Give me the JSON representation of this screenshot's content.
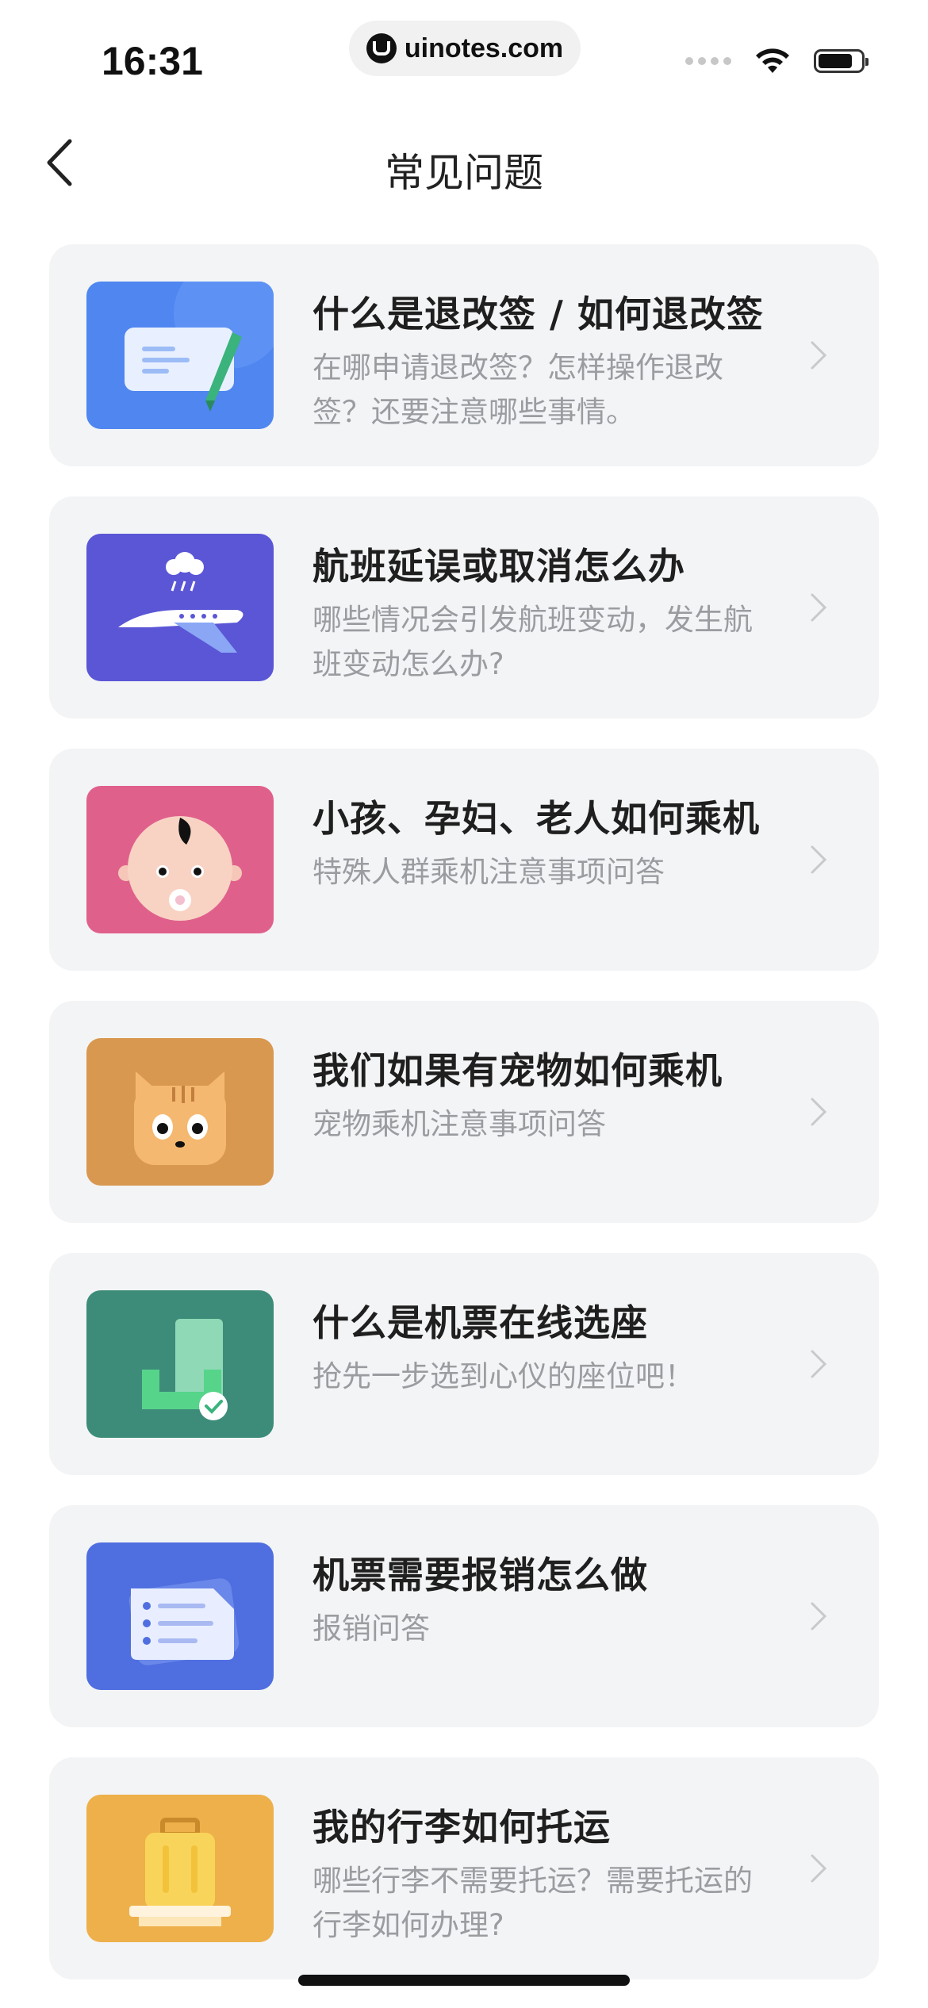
{
  "status_bar": {
    "time": "16:31",
    "watermark": "uinotes.com"
  },
  "nav": {
    "title": "常见问题",
    "back_icon": "chevron-left-icon"
  },
  "faq_items": [
    {
      "title": "什么是退改签 / 如何退改签",
      "desc": "在哪申请退改签？怎样操作退改签？还要注意哪些事情。",
      "icon": "ticket-edit-icon",
      "color": "#4f86f0"
    },
    {
      "title": "航班延误或取消怎么办",
      "desc": "哪些情况会引发航班变动，发生航班变动怎么办?",
      "icon": "airplane-rain-icon",
      "color": "#5a56d6"
    },
    {
      "title": "小孩、孕妇、老人如何乘机",
      "desc": "特殊人群乘机注意事项问答",
      "icon": "baby-icon",
      "color": "#e0608c"
    },
    {
      "title": "我们如果有宠物如何乘机",
      "desc": "宠物乘机注意事项问答",
      "icon": "cat-icon",
      "color": "#d99850"
    },
    {
      "title": "什么是机票在线选座",
      "desc": "抢先一步选到心仪的座位吧！",
      "icon": "seat-check-icon",
      "color": "#3d8c7a"
    },
    {
      "title": "机票需要报销怎么做",
      "desc": "报销问答",
      "icon": "document-list-icon",
      "color": "#4f6fe0"
    },
    {
      "title": "我的行李如何托运",
      "desc": "哪些行李不需要托运？需要托运的行李如何办理?",
      "icon": "luggage-icon",
      "color": "#eeb04a"
    }
  ]
}
